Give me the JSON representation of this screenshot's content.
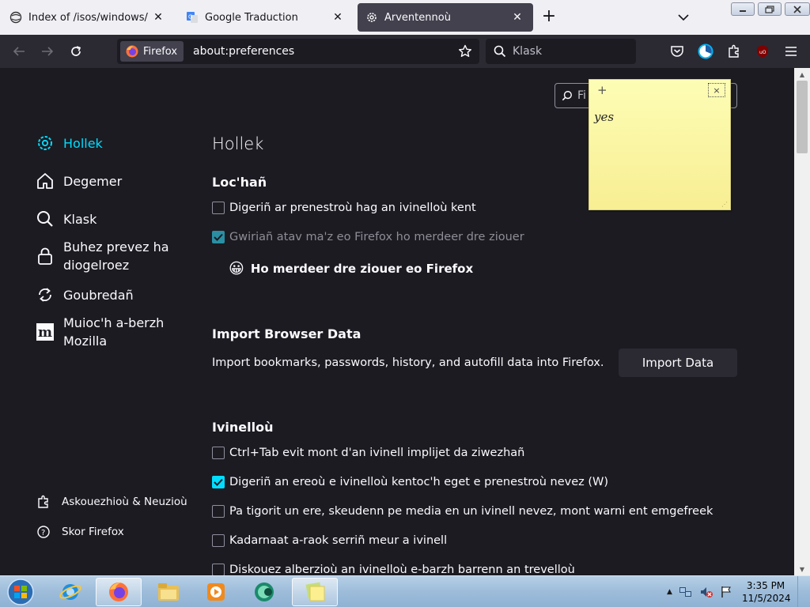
{
  "tabs": [
    {
      "title": "Index of /isos/windows/",
      "icon": "globe-icon"
    },
    {
      "title": "Google Traduction",
      "icon": "google-translate-icon"
    },
    {
      "title": "Arventennoù",
      "icon": "gear-icon",
      "active": true
    }
  ],
  "navbar": {
    "identity_label": "Firefox",
    "url": "about:preferences",
    "search_placeholder": "Klask"
  },
  "sidebar": {
    "items": [
      {
        "label": "Hollek",
        "icon": "gear-icon",
        "selected": true
      },
      {
        "label": "Degemer",
        "icon": "home-icon"
      },
      {
        "label": "Klask",
        "icon": "search-icon"
      },
      {
        "label": "Buhez prevez ha diogelroez",
        "icon": "lock-icon"
      },
      {
        "label": "Goubredañ",
        "icon": "sync-icon"
      },
      {
        "label": "Muioc'h a-berzh Mozilla",
        "icon": "mozilla-icon"
      }
    ],
    "footer": [
      {
        "label": "Askouezhioù & Neuzioù",
        "icon": "puzzle-icon"
      },
      {
        "label": "Skor Firefox",
        "icon": "help-icon"
      }
    ]
  },
  "find_placeholder": "Fi",
  "page": {
    "title": "Hollek",
    "startup": {
      "heading": "Loc'hañ",
      "options": [
        {
          "label": "Digeriñ ar prenestroù hag an ivinelloù kent",
          "checked": false,
          "disabled": false
        },
        {
          "label": "Gwiriañ atav ma'z eo Firefox ho merdeer dre ziouer",
          "checked": true,
          "disabled": true
        }
      ],
      "default_browser_text": "Ho merdeer dre ziouer eo Firefox",
      "default_browser_emoji": "😀"
    },
    "import": {
      "heading": "Import Browser Data",
      "description": "Import bookmarks, passwords, history, and autofill data into Firefox.",
      "button": "Import Data"
    },
    "tabs_section": {
      "heading": "Ivinelloù",
      "options": [
        {
          "label": "Ctrl+Tab evit mont d'an ivinell implijet da ziwezhañ",
          "checked": false
        },
        {
          "label": "Digeriñ an ereoù e ivinelloù kentoc'h eget e prenestroù nevez (W)",
          "checked": true
        },
        {
          "label": "Pa tigorit un ere, skeudenn pe media en un ivinell nevez, mont warni ent emgefreek",
          "checked": false
        },
        {
          "label": "Kadarnaat a-raok serriñ meur a ivinell",
          "checked": false
        },
        {
          "label": "Diskouez alberzioù an ivinelloù e-barzh barrenn an trevelloù",
          "checked": false
        }
      ]
    }
  },
  "sticky_note": {
    "plus": "+",
    "close": "×",
    "text": "yes"
  },
  "taskbar": {
    "apps": [
      "internet-explorer-icon",
      "firefox-icon",
      "file-explorer-icon",
      "media-player-icon",
      "app-icon",
      "sticky-notes-icon"
    ],
    "time": "3:35 PM",
    "date": "11/5/2024"
  },
  "colors": {
    "accent": "#00ddff",
    "background": "#1c1b22",
    "toolbar": "#2b2a33"
  }
}
